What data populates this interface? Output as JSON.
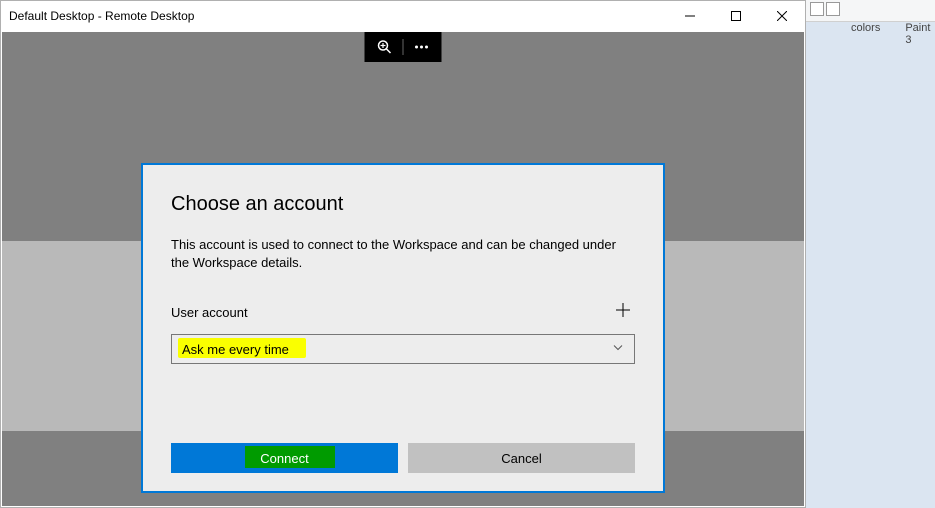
{
  "window": {
    "title": "Default Desktop - Remote Desktop"
  },
  "dialog": {
    "title": "Choose an account",
    "description": "This account is used to connect to the Workspace and can be changed under the Workspace details.",
    "user_account_label": "User account",
    "select_value": "Ask me every time",
    "connect_label": "Connect",
    "cancel_label": "Cancel"
  },
  "rightstrip": {
    "label1": "colors",
    "label2": "Paint 3"
  }
}
